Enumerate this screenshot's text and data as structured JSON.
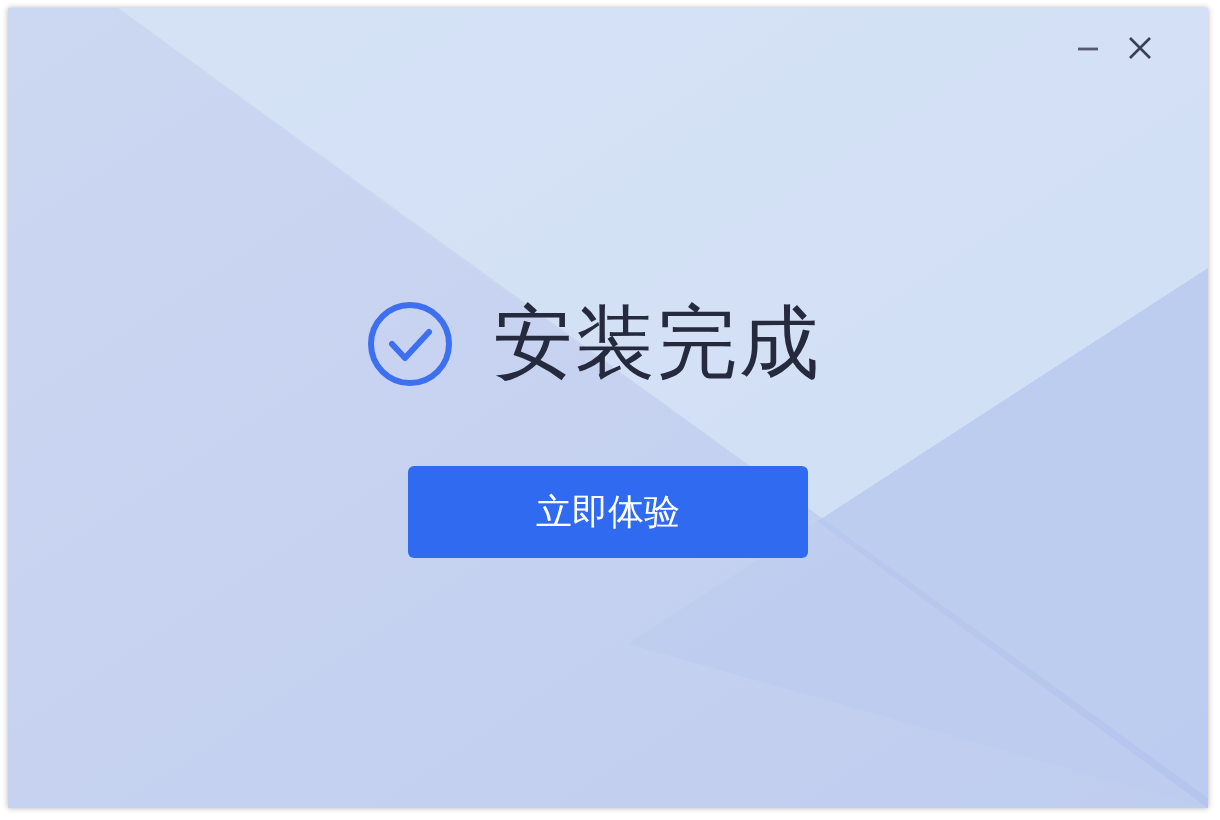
{
  "status": {
    "kind": "success",
    "title": "安装完成"
  },
  "buttons": [
    {
      "label": "立即体验"
    }
  ]
}
